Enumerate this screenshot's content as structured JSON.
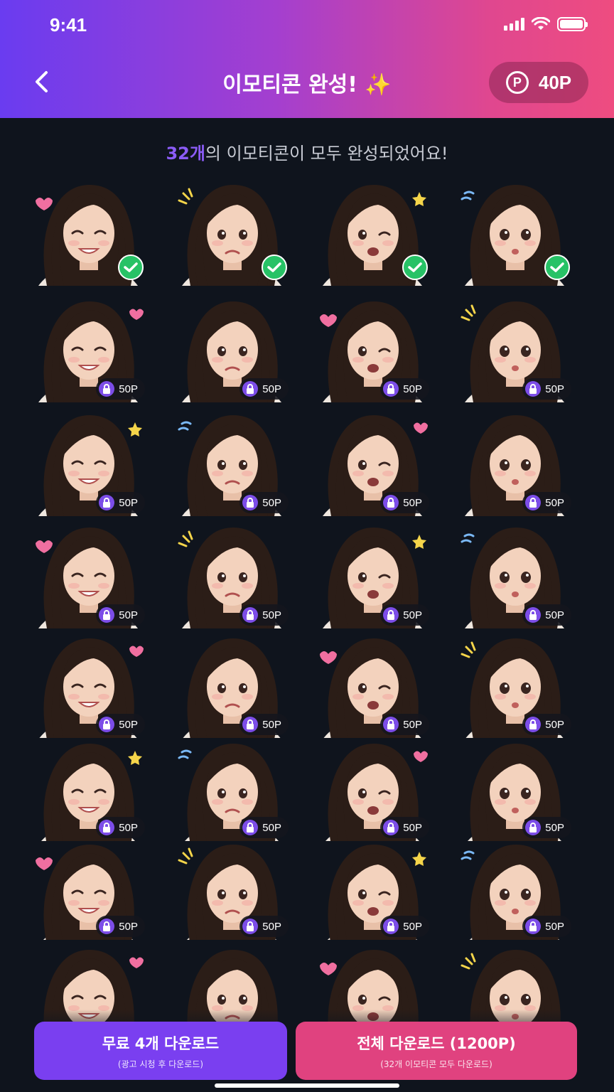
{
  "status_bar": {
    "time": "9:41"
  },
  "header": {
    "title": "이모티콘 완성! ✨",
    "points": "40P"
  },
  "message": {
    "count": "32개",
    "text": "의 이모티콘이 모두 완성되었어요!"
  },
  "colors": {
    "header_start": "#6a3cf0",
    "header_end": "#ee4c80",
    "background": "#0f141d",
    "accent_purple": "#8b5cf6",
    "check_green": "#27c266",
    "free_button": "#7a3ff0",
    "all_button": "#e0427f"
  },
  "emoticons": [
    {
      "expression": "smile-hearts",
      "status": "unlocked"
    },
    {
      "expression": "sad-tear",
      "status": "unlocked"
    },
    {
      "expression": "angry",
      "status": "unlocked"
    },
    {
      "expression": "surprised-hand",
      "status": "unlocked"
    },
    {
      "expression": "heart-eyes-kiss",
      "status": "locked",
      "price": "50P"
    },
    {
      "expression": "crying",
      "status": "locked",
      "price": "50P"
    },
    {
      "expression": "laughing-kk",
      "status": "locked",
      "price": "50P"
    },
    {
      "expression": "thinking-chin",
      "status": "locked",
      "price": "50P"
    },
    {
      "expression": "huff-pout",
      "status": "locked",
      "price": "50P"
    },
    {
      "expression": "worried",
      "status": "locked",
      "price": "50P"
    },
    {
      "expression": "shocked-hands",
      "status": "locked",
      "price": "50P"
    },
    {
      "expression": "wink-star",
      "status": "locked",
      "price": "50P"
    },
    {
      "expression": "grin-sparkle",
      "status": "locked",
      "price": "50P"
    },
    {
      "expression": "sleepy-zzz",
      "status": "locked",
      "price": "50P"
    },
    {
      "expression": "wailing",
      "status": "locked",
      "price": "50P"
    },
    {
      "expression": "smug-chin",
      "status": "locked",
      "price": "50P"
    },
    {
      "expression": "peace-wink",
      "status": "locked",
      "price": "50P"
    },
    {
      "expression": "nervous",
      "status": "locked",
      "price": "50P"
    },
    {
      "expression": "cheeks-hearts",
      "status": "locked",
      "price": "50P"
    },
    {
      "expression": "pouting",
      "status": "locked",
      "price": "50P"
    },
    {
      "expression": "question",
      "status": "locked",
      "price": "50P"
    },
    {
      "expression": "blow-kiss",
      "status": "locked",
      "price": "50P"
    },
    {
      "expression": "fighting",
      "status": "locked",
      "price": "50P"
    },
    {
      "expression": "sulky",
      "status": "locked",
      "price": "50P"
    },
    {
      "expression": "panic-sweat",
      "status": "locked",
      "price": "50P"
    },
    {
      "expression": "excited-sparkle",
      "status": "locked",
      "price": "50P"
    },
    {
      "expression": "dizzy",
      "status": "locked",
      "price": "50P"
    },
    {
      "expression": "laugh-sweat",
      "status": "locked",
      "price": "50P"
    },
    {
      "expression": "scream-lines",
      "status": "locked"
    },
    {
      "expression": "shy-heart",
      "status": "locked"
    },
    {
      "expression": "annoyed-puff",
      "status": "locked"
    },
    {
      "expression": "content-heart",
      "status": "locked"
    }
  ],
  "buttons": {
    "free": {
      "label": "무료 4개 다운로드",
      "sub": "(광고 시청 후 다운로드)"
    },
    "all": {
      "label": "전체 다운로드 (1200P)",
      "sub": "(32개 이모티콘 모두 다운로드)"
    }
  }
}
